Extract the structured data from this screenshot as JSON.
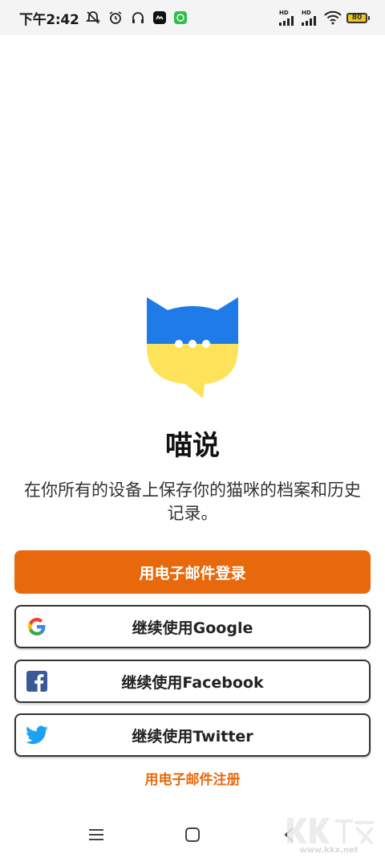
{
  "status_bar": {
    "time": "下午2:42",
    "signal1_label": "HD",
    "signal2_label": "HD",
    "battery": "80"
  },
  "app": {
    "title": "喵说",
    "subtitle": "在你所有的设备上保存你的猫咪的档案和历史记录。"
  },
  "buttons": {
    "email_login": "用电子邮件登录",
    "google": "继续使用Google",
    "facebook": "继续使用Facebook",
    "twitter": "继续使用Twitter"
  },
  "register_link": "用电子邮件注册",
  "watermark": {
    "main": "KK下载",
    "url": "www.kkx.net"
  },
  "colors": {
    "accent": "#e8690b",
    "logo_blue": "#1f7be8",
    "logo_yellow": "#fde25a"
  }
}
